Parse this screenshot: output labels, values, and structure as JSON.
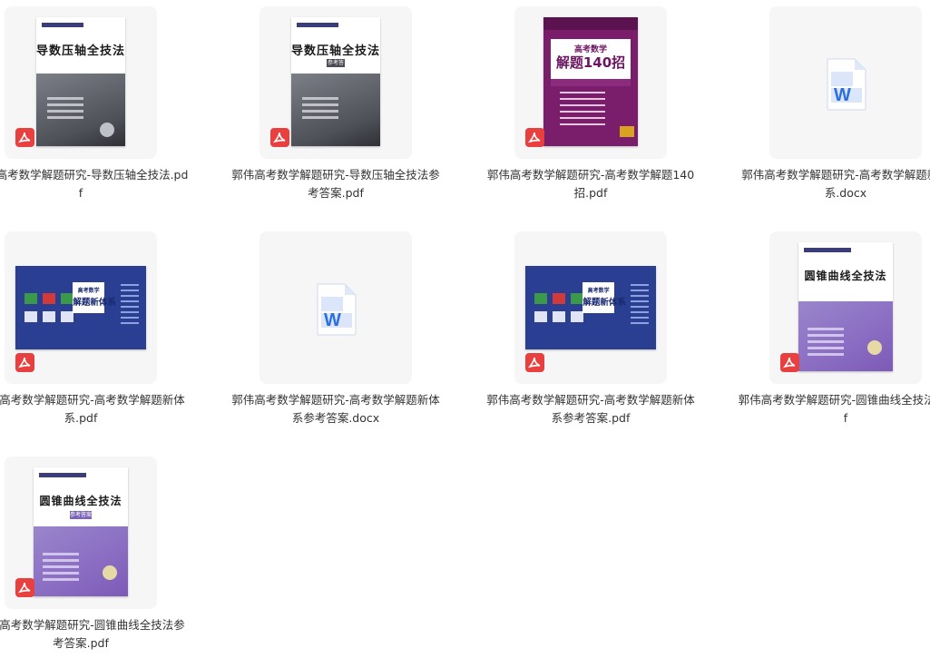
{
  "files": [
    {
      "name": "郭伟高考数学解题研究-导数压轴全技法.pdf",
      "type": "pdf",
      "cover": {
        "title": "导数压轴全技法",
        "subtitle": "",
        "icon": "pdf-icon"
      }
    },
    {
      "name": "郭伟高考数学解题研究-导数压轴全技法参考答案.pdf",
      "type": "pdf",
      "cover": {
        "title": "导数压轴全技法",
        "subtitle": "参考答案",
        "icon": "pdf-icon"
      }
    },
    {
      "name": "郭伟高考数学解题研究-高考数学解题140招.pdf",
      "type": "pdf",
      "cover": {
        "title": "高考数学",
        "subtitle": "解题140招",
        "icon": "pdf-icon"
      }
    },
    {
      "name": "郭伟高考数学解题研究-高考数学解题新体系.docx",
      "type": "docx",
      "cover": {
        "title": "",
        "subtitle": "",
        "icon": "word-doc-icon"
      }
    },
    {
      "name": "郭伟高考数学解题研究-高考数学解题新体系.pdf",
      "type": "pdf",
      "cover": {
        "title": "高考数学",
        "subtitle": "解题新体系",
        "icon": "pdf-icon"
      }
    },
    {
      "name": "郭伟高考数学解题研究-高考数学解题新体系参考答案.docx",
      "type": "docx",
      "cover": {
        "title": "",
        "subtitle": "",
        "icon": "word-doc-icon"
      }
    },
    {
      "name": "郭伟高考数学解题研究-高考数学解题新体系参考答案.pdf",
      "type": "pdf",
      "cover": {
        "title": "高考数学",
        "subtitle": "解题新体系",
        "icon": "pdf-icon"
      }
    },
    {
      "name": "郭伟高考数学解题研究-圆锥曲线全技法.pdf",
      "type": "pdf",
      "cover": {
        "title": "圆锥曲线全技法",
        "subtitle": "",
        "icon": "pdf-icon"
      }
    },
    {
      "name": "郭伟高考数学解题研究-圆锥曲线全技法参考答案.pdf",
      "type": "pdf",
      "cover": {
        "title": "圆锥曲线全技法",
        "subtitle": "参考答案",
        "icon": "pdf-icon"
      }
    }
  ],
  "colors": {
    "pdf_badge": "#e83f3f",
    "word_blue": "#2b6fe0",
    "tile_bg": "#f6f6f7",
    "text": "#333333"
  }
}
